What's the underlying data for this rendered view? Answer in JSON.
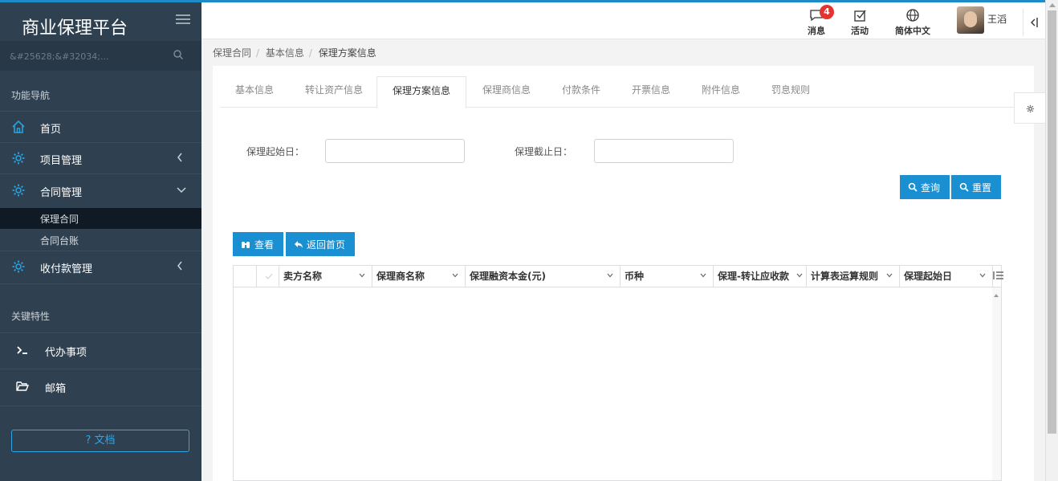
{
  "app": {
    "title": "商业保理平台"
  },
  "sidebar": {
    "search_placeholder": "&#25628;&#32034;...",
    "nav_section": "功能导航",
    "items": [
      {
        "label": "首页",
        "icon": "home-icon"
      },
      {
        "label": "项目管理",
        "icon": "gear-icon"
      },
      {
        "label": "合同管理",
        "icon": "gear-icon"
      },
      {
        "label": "收付款管理",
        "icon": "gear-icon"
      }
    ],
    "sub_items": [
      {
        "label": "保理合同",
        "active": true
      },
      {
        "label": "合同台账",
        "active": false
      }
    ],
    "key_section": "关键特性",
    "key_items": [
      {
        "label": "代办事项",
        "icon": "terminal-icon"
      },
      {
        "label": "邮箱",
        "icon": "folder-open-icon"
      }
    ],
    "doc_button": "? 文档"
  },
  "topbar": {
    "messages": {
      "label": "消息",
      "badge": "4"
    },
    "activity": {
      "label": "活动"
    },
    "language": {
      "label": "简体中文"
    },
    "user": {
      "name": "王滔"
    }
  },
  "breadcrumb": [
    "保理合同",
    "基本信息",
    "保理方案信息"
  ],
  "tabs": [
    "基本信息",
    "转让资产信息",
    "保理方案信息",
    "保理商信息",
    "付款条件",
    "开票信息",
    "附件信息",
    "罚息规则"
  ],
  "active_tab": "保理方案信息",
  "form": {
    "start_label": "保理起始日：",
    "start_value": "",
    "end_label": "保理截止日：",
    "end_value": "",
    "query_button": "查询",
    "reset_button": "重置"
  },
  "toolbar": {
    "view_button": "查看",
    "back_button": "返回首页"
  },
  "table": {
    "columns": [
      "卖方名称",
      "保理商名称",
      "保理融资本金(元)",
      "币种",
      "保理-转让应收款",
      "计算表运算规则",
      "保理起始日"
    ],
    "rows": []
  },
  "colors": {
    "accent": "#1a8fd1",
    "sidebar": "#2f4050",
    "badge": "#e3342f"
  }
}
